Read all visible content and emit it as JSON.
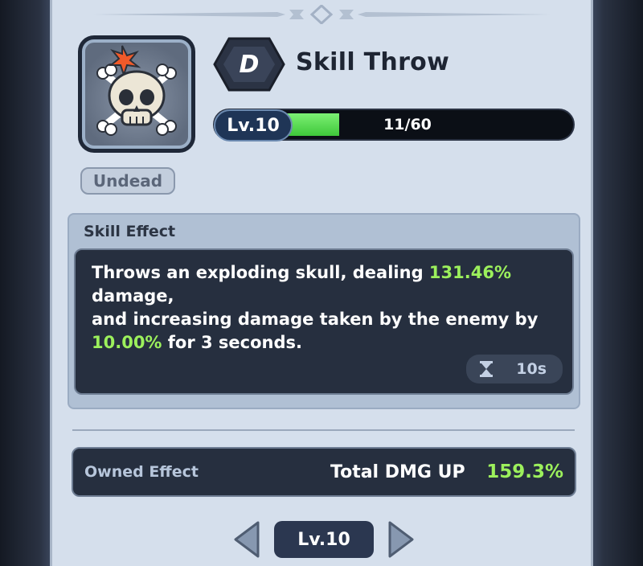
{
  "skill": {
    "rank": "D",
    "name": "Skill Throw",
    "icon": "skull-bomb-icon",
    "tag": "Undead"
  },
  "level": {
    "label": "Lv.10",
    "progress_text": "11/60",
    "progress_fraction": 0.1833
  },
  "skill_effect": {
    "title": "Skill Effect",
    "line1_pre": "Throws an exploding skull, dealing ",
    "line1_value": "131.46%",
    "line2": "damage,",
    "line3": "and increasing damage taken by the enemy by",
    "line4_value": "10.00%",
    "line4_post": " for 3 seconds.",
    "cooldown_icon": "hourglass-icon",
    "cooldown": "10s"
  },
  "owned_effect": {
    "label": "Owned Effect",
    "stat": "Total DMG UP",
    "value": "159.3%"
  },
  "nav": {
    "level_label": "Lv.10",
    "prev_icon": "chevron-left-icon",
    "next_icon": "chevron-right-icon"
  },
  "colors": {
    "panel": "#d5dfec",
    "highlight": "#9cf05c",
    "progress": "#4fd447",
    "dark": "#262f3f"
  }
}
